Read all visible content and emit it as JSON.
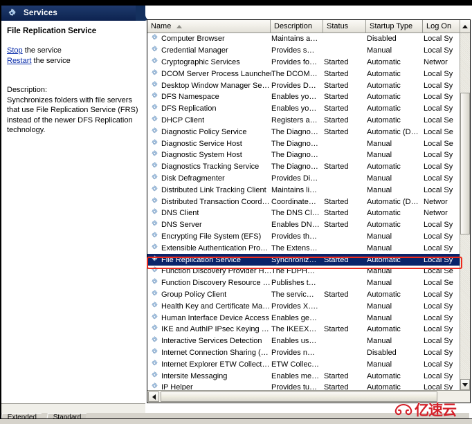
{
  "window": {
    "title": "Services",
    "title_icon": "gear-icon"
  },
  "details": {
    "service_name": "File Replication Service",
    "links": [
      {
        "link": "Stop",
        "suffix": " the service"
      },
      {
        "link": "Restart",
        "suffix": " the service"
      }
    ],
    "description_label": "Description:",
    "description_text": "Synchronizes folders with file servers that use File Replication Service (FRS) instead of the newer DFS Replication technology."
  },
  "tabs": [
    {
      "label": "Extended",
      "selected": false
    },
    {
      "label": "Standard",
      "selected": true
    }
  ],
  "list": {
    "columns": [
      {
        "key": "name",
        "label": "Name",
        "sort": "asc"
      },
      {
        "key": "desc",
        "label": "Description",
        "sort": ""
      },
      {
        "key": "status",
        "label": "Status",
        "sort": ""
      },
      {
        "key": "startup",
        "label": "Startup Type",
        "sort": ""
      },
      {
        "key": "logon",
        "label": "Log On",
        "sort": ""
      }
    ],
    "selected_index": 19,
    "rows": [
      {
        "name": "Computer Browser",
        "desc": "Maintains a…",
        "status": "",
        "startup": "Disabled",
        "logon": "Local Sy"
      },
      {
        "name": "Credential Manager",
        "desc": "Provides s…",
        "status": "",
        "startup": "Manual",
        "logon": "Local Sy"
      },
      {
        "name": "Cryptographic Services",
        "desc": "Provides fo…",
        "status": "Started",
        "startup": "Automatic",
        "logon": "Networ"
      },
      {
        "name": "DCOM Server Process Launcher",
        "desc": "The DCOM…",
        "status": "Started",
        "startup": "Automatic",
        "logon": "Local Sy"
      },
      {
        "name": "Desktop Window Manager Se…",
        "desc": "Provides D…",
        "status": "Started",
        "startup": "Automatic",
        "logon": "Local Sy"
      },
      {
        "name": "DFS Namespace",
        "desc": "Enables yo…",
        "status": "Started",
        "startup": "Automatic",
        "logon": "Local Sy"
      },
      {
        "name": "DFS Replication",
        "desc": "Enables yo…",
        "status": "Started",
        "startup": "Automatic",
        "logon": "Local Sy"
      },
      {
        "name": "DHCP Client",
        "desc": "Registers a…",
        "status": "Started",
        "startup": "Automatic",
        "logon": "Local Se"
      },
      {
        "name": "Diagnostic Policy Service",
        "desc": "The Diagno…",
        "status": "Started",
        "startup": "Automatic (D…",
        "logon": "Local Se"
      },
      {
        "name": "Diagnostic Service Host",
        "desc": "The Diagno…",
        "status": "",
        "startup": "Manual",
        "logon": "Local Se"
      },
      {
        "name": "Diagnostic System Host",
        "desc": "The Diagno…",
        "status": "",
        "startup": "Manual",
        "logon": "Local Sy"
      },
      {
        "name": "Diagnostics Tracking Service",
        "desc": "The Diagno…",
        "status": "Started",
        "startup": "Automatic",
        "logon": "Local Sy"
      },
      {
        "name": "Disk Defragmenter",
        "desc": "Provides Di…",
        "status": "",
        "startup": "Manual",
        "logon": "Local Sy"
      },
      {
        "name": "Distributed Link Tracking Client",
        "desc": "Maintains li…",
        "status": "",
        "startup": "Manual",
        "logon": "Local Sy"
      },
      {
        "name": "Distributed Transaction Coord…",
        "desc": "Coordinate…",
        "status": "Started",
        "startup": "Automatic (D…",
        "logon": "Networ"
      },
      {
        "name": "DNS Client",
        "desc": "The DNS Cl…",
        "status": "Started",
        "startup": "Automatic",
        "logon": "Networ"
      },
      {
        "name": "DNS Server",
        "desc": "Enables DN…",
        "status": "Started",
        "startup": "Automatic",
        "logon": "Local Sy"
      },
      {
        "name": "Encrypting File System (EFS)",
        "desc": "Provides th…",
        "status": "",
        "startup": "Manual",
        "logon": "Local Sy"
      },
      {
        "name": "Extensible Authentication Pro…",
        "desc": "The Extens…",
        "status": "",
        "startup": "Manual",
        "logon": "Local Sy"
      },
      {
        "name": "File Replication Service",
        "desc": "Synchroniz…",
        "status": "Started",
        "startup": "Automatic",
        "logon": "Local Sy"
      },
      {
        "name": "Function Discovery Provider H…",
        "desc": "The FDPH…",
        "status": "",
        "startup": "Manual",
        "logon": "Local Se"
      },
      {
        "name": "Function Discovery Resource …",
        "desc": "Publishes t…",
        "status": "",
        "startup": "Manual",
        "logon": "Local Se"
      },
      {
        "name": "Group Policy Client",
        "desc": "The servic…",
        "status": "Started",
        "startup": "Automatic",
        "logon": "Local Sy"
      },
      {
        "name": "Health Key and Certificate Ma…",
        "desc": "Provides X….",
        "status": "",
        "startup": "Manual",
        "logon": "Local Sy"
      },
      {
        "name": "Human Interface Device Access",
        "desc": "Enables ge…",
        "status": "",
        "startup": "Manual",
        "logon": "Local Sy"
      },
      {
        "name": "IKE and AuthIP IPsec Keying …",
        "desc": "The IKEEX…",
        "status": "Started",
        "startup": "Automatic",
        "logon": "Local Sy"
      },
      {
        "name": "Interactive Services Detection",
        "desc": "Enables us…",
        "status": "",
        "startup": "Manual",
        "logon": "Local Sy"
      },
      {
        "name": "Internet Connection Sharing (…",
        "desc": "Provides n…",
        "status": "",
        "startup": "Disabled",
        "logon": "Local Sy"
      },
      {
        "name": "Internet Explorer ETW Collect…",
        "desc": "ETW Collec…",
        "status": "",
        "startup": "Manual",
        "logon": "Local Sy"
      },
      {
        "name": "Intersite Messaging",
        "desc": "Enables me…",
        "status": "Started",
        "startup": "Automatic",
        "logon": "Local Sy"
      },
      {
        "name": "IP Helper",
        "desc": "Provides tu…",
        "status": "Started",
        "startup": "Automatic",
        "logon": "Local Sy"
      }
    ]
  },
  "annotation": {
    "color": "#ed2a1c",
    "target": "File Replication Service"
  },
  "watermark": {
    "text": "亿速云",
    "color": "#d4212a"
  },
  "colors": {
    "titlebar": "#14305e",
    "selection": "#0a246a",
    "link": "#0a2dab"
  }
}
